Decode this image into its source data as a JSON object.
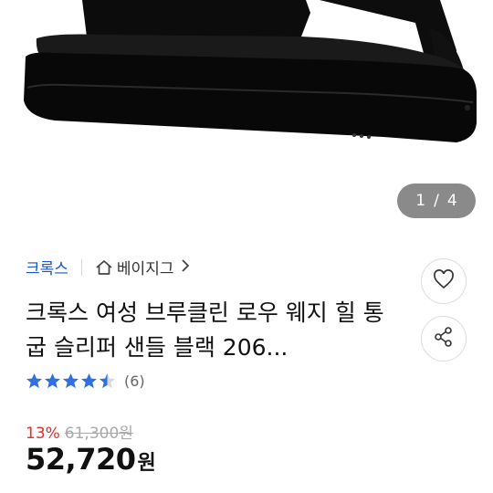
{
  "gallery": {
    "current": "1",
    "separator": "/",
    "total": "4"
  },
  "breadcrumb": {
    "brand": "크록스",
    "category": "베이지그"
  },
  "product": {
    "title": "크록스 여성 브루클린 로우 웨지 힐 통굽 슬리퍼 샌들 블랙 206..."
  },
  "rating": {
    "stars": 4.5,
    "count_text": "(6)"
  },
  "price": {
    "discount": "13%",
    "original": "61,300원",
    "sale": "52,720",
    "currency": "원"
  },
  "colors": {
    "brand_link": "#1a55c9",
    "star": "#2f6fe0",
    "discount": "#e52b2b",
    "counter_bg": "#8a8a8a"
  },
  "icons": {
    "home": "home-icon",
    "chevron": "chevron-right-icon",
    "heart": "heart-icon",
    "share": "share-icon",
    "star": "star-icon"
  }
}
